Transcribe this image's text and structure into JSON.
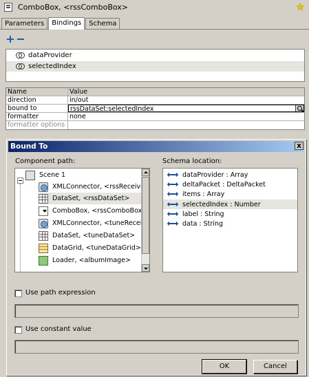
{
  "header": {
    "title": "ComboBox, <rssComboBox>",
    "component_icon": "component-icon",
    "favorite_icon": "star-icon"
  },
  "tabs": [
    {
      "label": "Parameters",
      "active": false
    },
    {
      "label": "Bindings",
      "active": true
    },
    {
      "label": "Schema",
      "active": false
    }
  ],
  "toolbar": {
    "add_icon": "plus-icon",
    "remove_icon": "minus-icon"
  },
  "bindings": [
    {
      "label": "dataProvider",
      "selected": false
    },
    {
      "label": "selectedIndex",
      "selected": true
    }
  ],
  "properties": {
    "headers": {
      "name": "Name",
      "value": "Value"
    },
    "rows": [
      {
        "name": "direction",
        "value": "in/out"
      },
      {
        "name": "bound to",
        "value": "rssDataSet:selectedIndex"
      },
      {
        "name": "formatter",
        "value": "none"
      },
      {
        "name": "formatter options",
        "value": ""
      }
    ]
  },
  "dialog": {
    "title": "Bound To",
    "close_label": "x",
    "component_path_label": "Component path:",
    "schema_location_label": "Schema location:",
    "tree": [
      {
        "label": "Scene 1",
        "icon": "scene-icon"
      },
      {
        "label": "XMLConnector, <rssReceiveXMl",
        "icon": "xml-connector-icon"
      },
      {
        "label": "DataSet, <rssDataSet>",
        "icon": "dataset-icon",
        "selected": true
      },
      {
        "label": "ComboBox, <rssComboBox>",
        "icon": "combobox-icon"
      },
      {
        "label": "XMLConnector, <tuneReceiveXl",
        "icon": "xml-connector-icon"
      },
      {
        "label": "DataSet, <tuneDataSet>",
        "icon": "dataset-icon"
      },
      {
        "label": "DataGrid, <tuneDataGrid>",
        "icon": "datagrid-icon"
      },
      {
        "label": "Loader, <albumImage>",
        "icon": "loader-icon"
      }
    ],
    "schema": [
      {
        "label": "dataProvider : Array"
      },
      {
        "label": "deltaPacket : DeltaPacket"
      },
      {
        "label": "items : Array"
      },
      {
        "label": "selectedIndex : Number",
        "selected": true
      },
      {
        "label": "label : String"
      },
      {
        "label": "data : String"
      }
    ],
    "use_path_expression": {
      "label": "Use path expression",
      "checked": false,
      "value": ""
    },
    "use_constant_value": {
      "label": "Use constant value",
      "checked": false,
      "value": ""
    },
    "ok_label": "OK",
    "cancel_label": "Cancel"
  },
  "colors": {
    "dialog_title_start": "#0a246a",
    "dialog_title_end": "#a6caf0",
    "selection": "#e6e4de",
    "face": "#d4d0c8"
  }
}
